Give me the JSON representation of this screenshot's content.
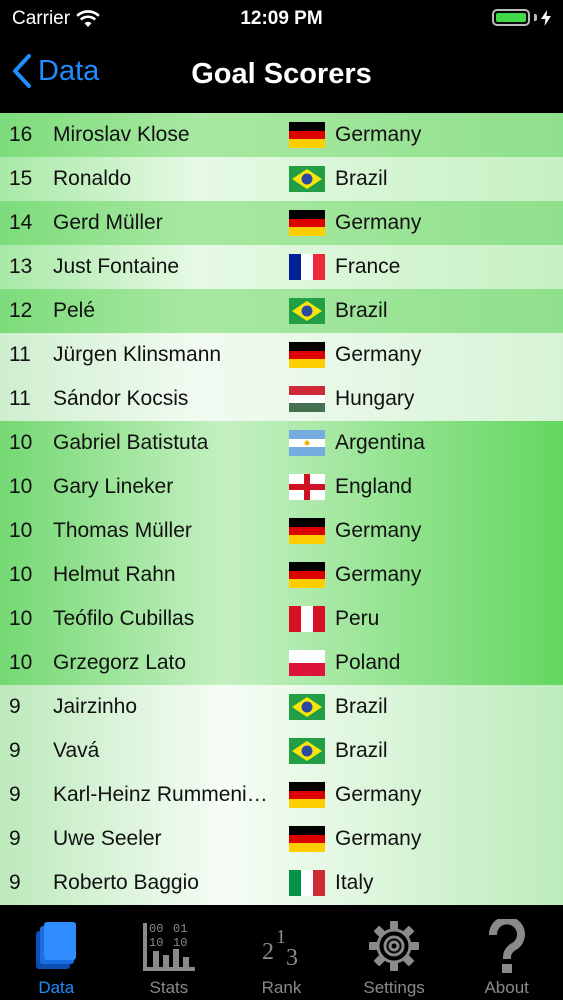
{
  "status_bar": {
    "carrier": "Carrier",
    "time": "12:09 PM"
  },
  "nav": {
    "back_label": "Data",
    "title": "Goal Scorers"
  },
  "rows": [
    {
      "goals": "16",
      "name": "Miroslav Klose",
      "flag": "germany-flag-icon",
      "country": "Germany"
    },
    {
      "goals": "15",
      "name": "Ronaldo",
      "flag": "brazil-flag-icon",
      "country": "Brazil"
    },
    {
      "goals": "14",
      "name": "Gerd Müller",
      "flag": "germany-flag-icon",
      "country": "Germany"
    },
    {
      "goals": "13",
      "name": "Just Fontaine",
      "flag": "france-flag-icon",
      "country": "France"
    },
    {
      "goals": "12",
      "name": "Pelé",
      "flag": "brazil-flag-icon",
      "country": "Brazil"
    },
    {
      "goals": "11",
      "name": "Jürgen Klinsmann",
      "flag": "germany-flag-icon",
      "country": "Germany"
    },
    {
      "goals": "11",
      "name": "Sándor Kocsis",
      "flag": "hungary-flag-icon",
      "country": "Hungary"
    },
    {
      "goals": "10",
      "name": "Gabriel Batistuta",
      "flag": "argentina-flag-icon",
      "country": "Argentina"
    },
    {
      "goals": "10",
      "name": "Gary Lineker",
      "flag": "england-flag-icon",
      "country": "England"
    },
    {
      "goals": "10",
      "name": "Thomas Müller",
      "flag": "germany-flag-icon",
      "country": "Germany"
    },
    {
      "goals": "10",
      "name": "Helmut Rahn",
      "flag": "germany-flag-icon",
      "country": "Germany"
    },
    {
      "goals": "10",
      "name": "Teófilo Cubillas",
      "flag": "peru-flag-icon",
      "country": "Peru"
    },
    {
      "goals": "10",
      "name": "Grzegorz Lato",
      "flag": "poland-flag-icon",
      "country": "Poland"
    },
    {
      "goals": "9",
      "name": "Jairzinho",
      "flag": "brazil-flag-icon",
      "country": "Brazil"
    },
    {
      "goals": "9",
      "name": "Vavá",
      "flag": "brazil-flag-icon",
      "country": "Brazil"
    },
    {
      "goals": "9",
      "name": "Karl-Heinz Rummeni…",
      "flag": "germany-flag-icon",
      "country": "Germany"
    },
    {
      "goals": "9",
      "name": "Uwe Seeler",
      "flag": "germany-flag-icon",
      "country": "Germany"
    },
    {
      "goals": "9",
      "name": "Roberto Baggio",
      "flag": "italy-flag-icon",
      "country": "Italy"
    }
  ],
  "tabs": [
    {
      "label": "Data",
      "icon": "data-book-icon",
      "active": true
    },
    {
      "label": "Stats",
      "icon": "stats-chart-icon",
      "active": false
    },
    {
      "label": "Rank",
      "icon": "rank-icon",
      "active": false
    },
    {
      "label": "Settings",
      "icon": "gear-icon",
      "active": false
    },
    {
      "label": "About",
      "icon": "question-mark-icon",
      "active": false
    }
  ],
  "stats_icon_digits": [
    "00",
    "01",
    "10",
    "10"
  ],
  "rank_icon_digits": [
    "2",
    "1",
    "3"
  ],
  "colors": {
    "accent": "#1f8cff",
    "tab_inactive": "#8a8a8a",
    "battery": "#3fd94a"
  }
}
